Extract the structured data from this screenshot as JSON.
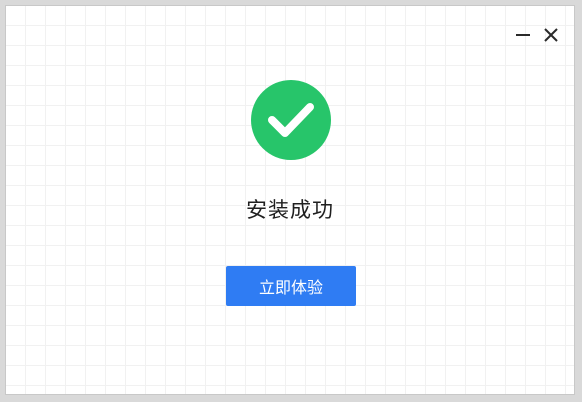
{
  "window": {
    "controls": {
      "minimize_icon": "minimize-icon",
      "close_icon": "close-icon"
    }
  },
  "status": {
    "icon": "check-circle-icon",
    "icon_color": "#27c56a",
    "message": "安装成功"
  },
  "actions": {
    "primary_label": "立即体验",
    "primary_color": "#2f7cf3"
  }
}
